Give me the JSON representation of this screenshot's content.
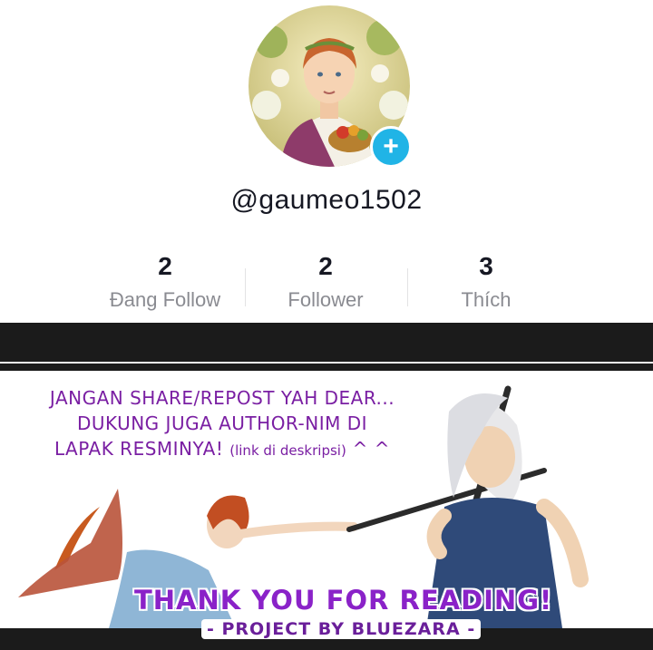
{
  "profile": {
    "username": "@gaumeo1502",
    "follow_button_icon": "plus-icon",
    "follow_button_symbol": "+",
    "accent_color": "#20b4e6"
  },
  "stats": [
    {
      "value": "2",
      "label": "Đang Follow"
    },
    {
      "value": "2",
      "label": "Follower"
    },
    {
      "value": "3",
      "label": "Thích"
    }
  ],
  "banner": {
    "notice_line1": "JANGAN SHARE/REPOST YAH DEAR...",
    "notice_line2": "DUKUNG JUGA AUTHOR-NIM DI",
    "notice_line3_main": "LAPAK RESMINYA!",
    "notice_line3_small": "(link di deskripsi)",
    "notice_line3_end": "^ ^",
    "thanks": "THANK YOU FOR READING!",
    "credit": "- PROJECT BY BLUEZARA -",
    "text_color": "#8a22c8"
  }
}
